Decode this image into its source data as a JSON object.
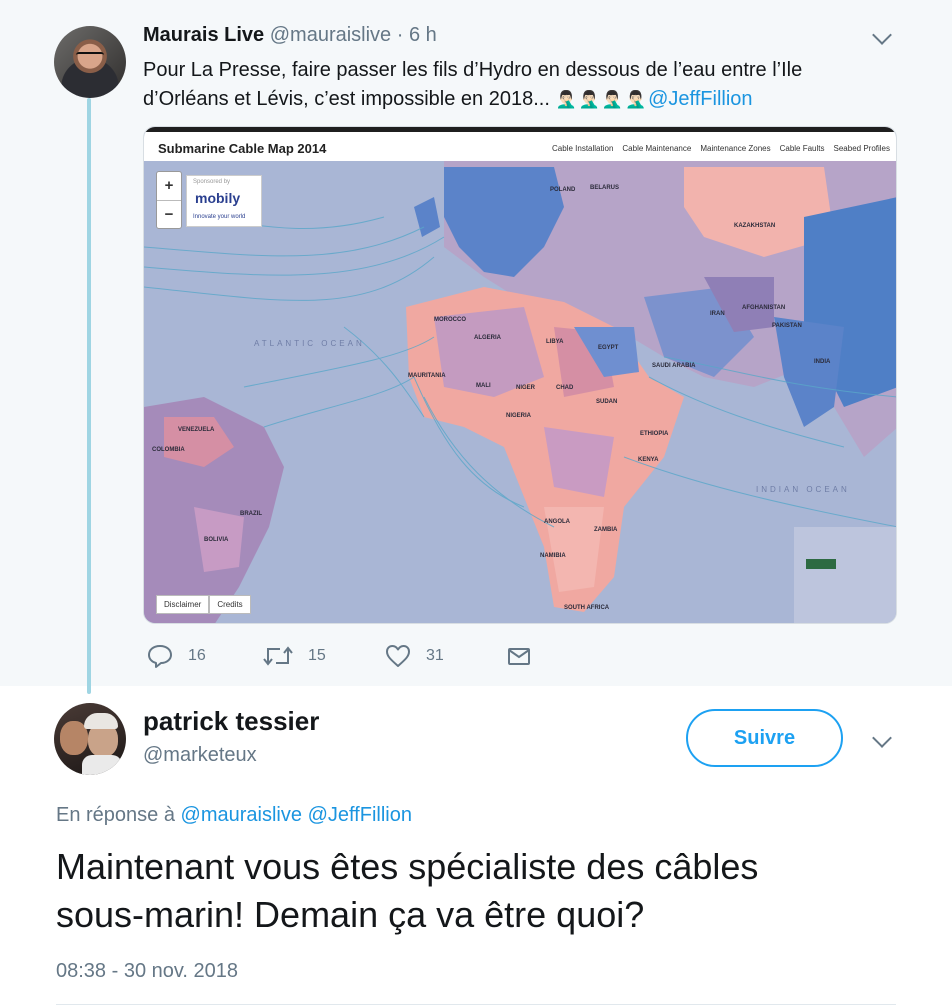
{
  "parent_tweet": {
    "display_name": "Maurais Live",
    "handle": "@mauraislive",
    "separator": "·",
    "time": "6 h",
    "text_line1": "Pour La Presse, faire passer les fils d’Hydro en dessous de l’eau entre l’Ile",
    "text_line2": "d’Orléans et Lévis, c’est impossible en 2018...",
    "emojis": "🤦🏻‍♂️🤦🏻‍♂️🤦🏻‍♂️🤦🏻‍♂️",
    "mention": "@JeffFillion",
    "actions": {
      "reply_count": "16",
      "retweet_count": "15",
      "like_count": "31"
    }
  },
  "map": {
    "title": "Submarine Cable Map 2014",
    "nav": [
      "Cable Installation",
      "Cable Maintenance",
      "Maintenance Zones",
      "Cable Faults",
      "Seabed Profiles"
    ],
    "zoom_in": "+",
    "zoom_out": "−",
    "sponsor_label": "Sponsored by",
    "sponsor_brand": "mobily",
    "sponsor_tagline": "Innovate your world",
    "atlantic_label": "ATLANTIC OCEAN",
    "indian_label": "INDIAN OCEAN",
    "buttons": [
      "Disclaimer",
      "Credits"
    ],
    "countries": [
      "POLAND",
      "BELARUS",
      "KAZAKHSTAN",
      "ALGERIA",
      "LIBYA",
      "EGYPT",
      "SAUDI ARABIA",
      "IRAN",
      "INDIA",
      "MALI",
      "NIGER",
      "CHAD",
      "SUDAN",
      "NIGERIA",
      "ETHIOPIA",
      "KENYA",
      "ANGOLA",
      "ZAMBIA",
      "NAMIBIA",
      "SOUTH AFRICA",
      "BRAZIL",
      "BOLIVIA",
      "COLOMBIA",
      "VENEZUELA",
      "MOROCCO",
      "MAURITANIA",
      "PAKISTAN",
      "AFGHANISTAN"
    ]
  },
  "reply_tweet": {
    "display_name": "patrick tessier",
    "handle": "@marketeux",
    "follow_label": "Suivre",
    "reply_prefix": "En réponse à",
    "reply_mention1": "@mauraislive",
    "reply_mention2": "@JeffFillion",
    "text_line1": "Maintenant vous êtes spécialiste des câbles",
    "text_line2": "sous-marin! Demain ça va être quoi?",
    "timestamp": "08:38 - 30 nov. 2018"
  },
  "colors": {
    "link": "#1b95e0",
    "follow": "#1da1f2",
    "muted": "#657786",
    "thread_line": "#9fd5e3",
    "parent_bg": "#f5f8fa"
  }
}
